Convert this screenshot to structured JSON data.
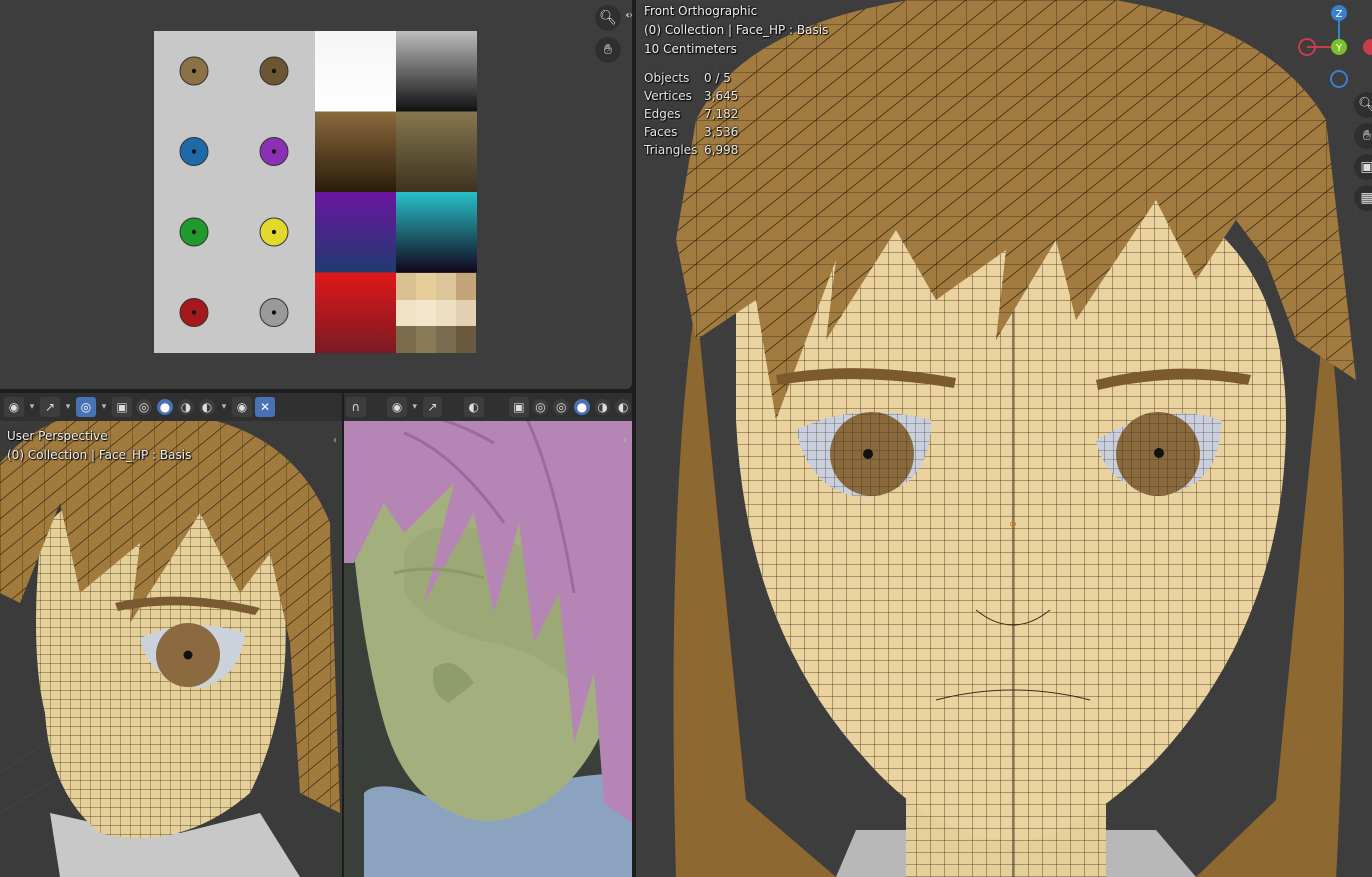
{
  "image_editor": {
    "swatches": [
      "#8c7146",
      "#6b5533",
      "#1e6aa8",
      "#8b2fb5",
      "#1f9b2e",
      "#e3d82e",
      "#a5181b",
      "#9a9a9a"
    ],
    "gradients": [
      [
        "#f5f5f5",
        "#ffffff"
      ],
      [
        "#bdbdbd",
        "#101010"
      ],
      [
        "#8a6a3c",
        "#2a1c0a"
      ],
      [
        "#86774e",
        "#3c3320"
      ],
      [
        "#6b15a0",
        "#203a70"
      ],
      [
        "#28c0c8",
        "#12061c"
      ],
      [
        "#e01818",
        "#7b1a24"
      ]
    ]
  },
  "viewport_left": {
    "view_name": "User Perspective",
    "collection": "(0) Collection | Face_HP : Basis"
  },
  "viewport_right": {
    "view_name": "Front Orthographic",
    "collection": "(0) Collection | Face_HP : Basis",
    "scale": "10 Centimeters",
    "stats": [
      {
        "label": "Objects",
        "value": "0 / 5"
      },
      {
        "label": "Vertices",
        "value": "3,645"
      },
      {
        "label": "Edges",
        "value": "7,182"
      },
      {
        "label": "Faces",
        "value": "3,536"
      },
      {
        "label": "Triangles",
        "value": "6,998"
      }
    ]
  },
  "gizmo": {
    "z": "Z",
    "y": "Y",
    "x_color": "#c83c4c",
    "y_color": "#7bbf2a",
    "z_color": "#3a7fd0"
  }
}
